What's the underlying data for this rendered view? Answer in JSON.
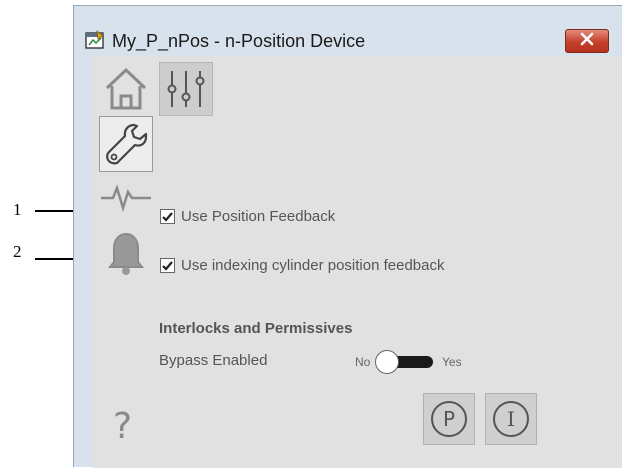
{
  "callouts": [
    {
      "number": "1"
    },
    {
      "number": "2"
    }
  ],
  "window": {
    "title": "My_P_nPos - n-Position Device",
    "icons": {
      "app": "faceplate-app-icon",
      "close": "close-icon"
    }
  },
  "nav": {
    "tabs": [
      {
        "name": "home",
        "icon": "home-icon",
        "active": false
      },
      {
        "name": "maintenance",
        "icon": "wrench-icon",
        "active": true
      },
      {
        "name": "trends",
        "icon": "trend-icon",
        "active": false
      },
      {
        "name": "alarms",
        "icon": "bell-icon",
        "active": false
      }
    ],
    "help_icon": "?"
  },
  "settings_icon": "sliders-icon",
  "options": [
    {
      "label": "Use Position Feedback",
      "checked": true
    },
    {
      "label": "Use indexing cylinder position feedback",
      "checked": true
    }
  ],
  "interlocks": {
    "heading": "Interlocks and Permissives",
    "bypass_label": "Bypass Enabled",
    "toggle_off_label": "No",
    "toggle_on_label": "Yes",
    "bypass_enabled": false
  },
  "bottom_buttons": [
    {
      "name": "permissives",
      "glyph": "P"
    },
    {
      "name": "interlocks",
      "glyph": "I"
    }
  ],
  "colors": {
    "close_button": "#c4402c",
    "toggle_track": "#1a1a1a",
    "panel_background": "#e1e1e1"
  }
}
